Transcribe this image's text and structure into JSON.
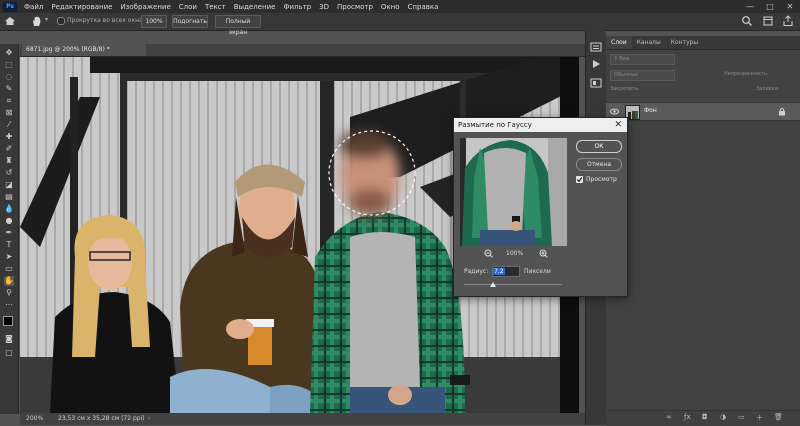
{
  "app": {
    "logo": "Ps"
  },
  "menu": [
    "Файл",
    "Редактирование",
    "Изображение",
    "Слои",
    "Текст",
    "Выделение",
    "Фильтр",
    "3D",
    "Просмотр",
    "Окно",
    "Справка"
  ],
  "window_controls": [
    "—",
    "□",
    "✕"
  ],
  "options_bar": {
    "scroll_all_label": "Прокрутка во всех окнах",
    "zoom_value": "100%",
    "fit_button": "Подогнать",
    "fullscreen_button": "Полный экран"
  },
  "document": {
    "tab_title": "6871.jpg @ 200% (RGB/8) *",
    "status_zoom": "200%",
    "status_size": "23,53 см x 35,28 см (72 ppi)"
  },
  "layers_panel": {
    "tabs": [
      "Слои",
      "Каналы",
      "Контуры"
    ],
    "active_tab": "Слои",
    "filter_placeholder": "Вид",
    "blend_mode": "Обычные",
    "opacity_label": "Непрозрачность:",
    "lock_label": "Закрепить:",
    "fill_label": "Заливка:",
    "layer_name": "Фон"
  },
  "gaussian_dialog": {
    "title": "Размытие по Гауссу",
    "ok_button": "ОК",
    "cancel_button": "Отмена",
    "preview_label": "Просмотр",
    "preview_checked": true,
    "zoom_percent": "100%",
    "radius_label": "Радиус:",
    "radius_value": "7,2",
    "radius_unit": "Пиксели",
    "slider_fraction": 0.3
  },
  "colors": {
    "accent": "#31a8ff",
    "bg": "#535353",
    "panel": "#424242",
    "dark": "#2d2d2d"
  }
}
